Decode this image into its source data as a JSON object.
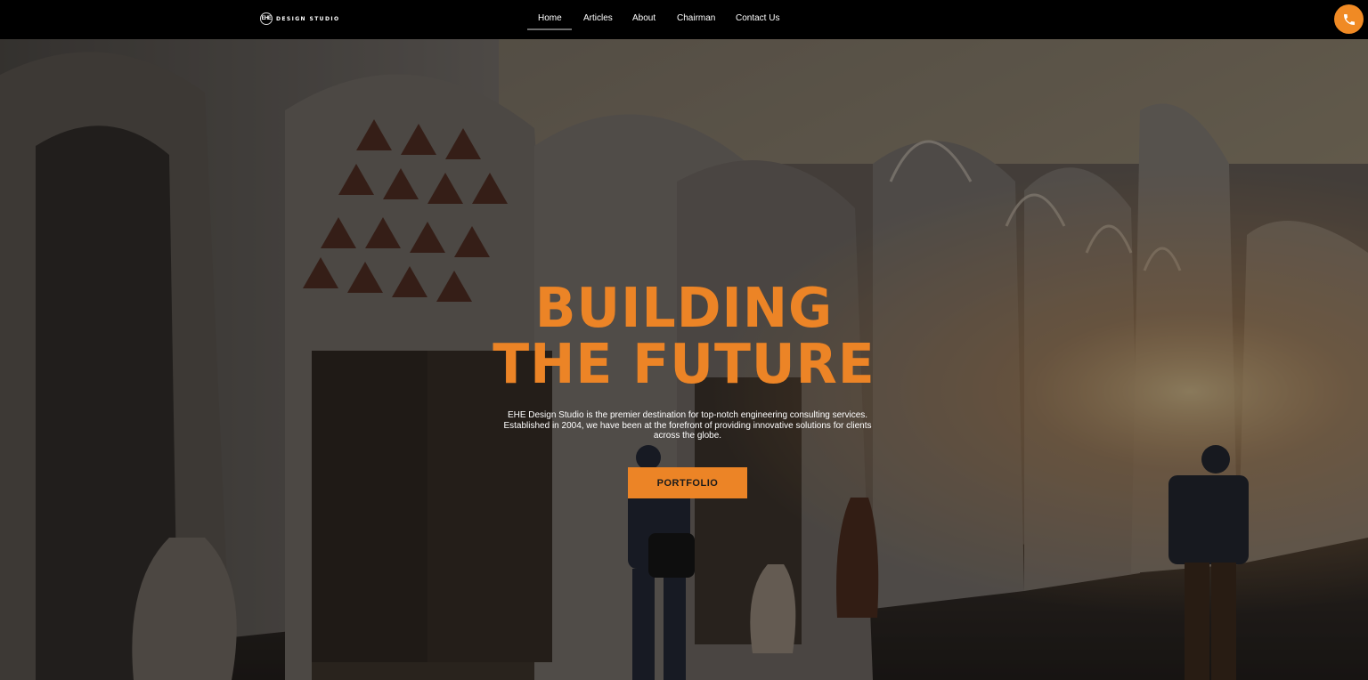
{
  "brand": {
    "logo_mark": "EHE",
    "logo_text": "DESIGN STUDIO"
  },
  "nav": {
    "items": [
      {
        "label": "Home",
        "active": true
      },
      {
        "label": "Articles",
        "active": false
      },
      {
        "label": "About",
        "active": false
      },
      {
        "label": "Chairman",
        "active": false
      },
      {
        "label": "Contact Us",
        "active": false
      }
    ],
    "phone_icon": "phone-icon"
  },
  "hero": {
    "title_line1": "BUILDING",
    "title_line2": "THE FUTURE",
    "description": "EHE Design Studio is the premier destination for top-notch engineering consulting services. Established in 2004, we have been at the forefront of providing innovative solutions for clients across the globe.",
    "cta_label": "PORTFOLIO"
  },
  "colors": {
    "accent": "#ec8426",
    "nav_bg": "#000000",
    "text": "#ffffff"
  }
}
